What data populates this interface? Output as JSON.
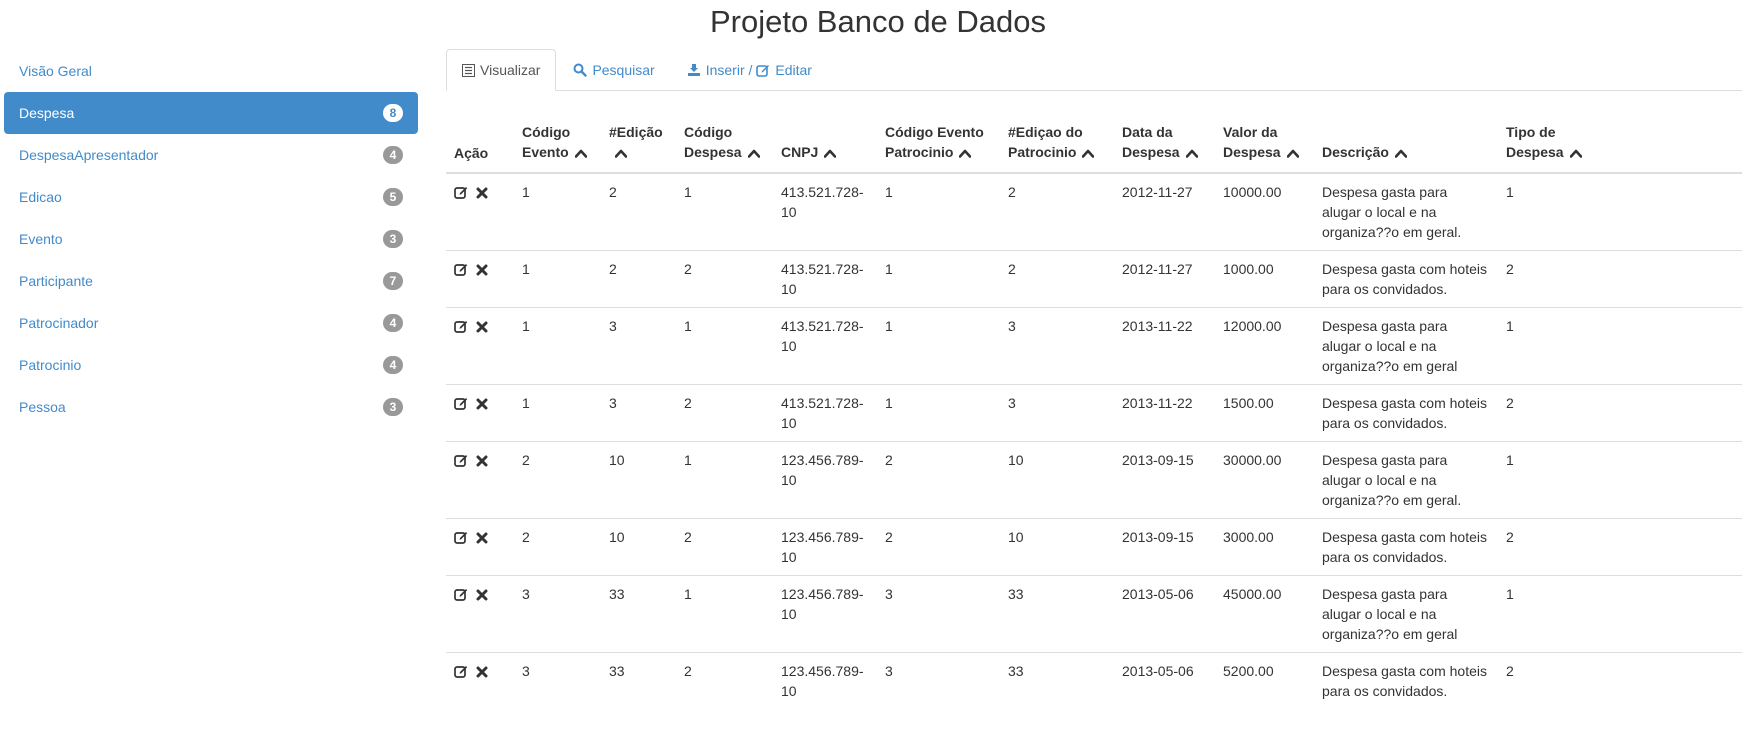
{
  "title": "Projeto Banco de Dados",
  "sidebar": {
    "items": [
      {
        "label": "Visão Geral",
        "badge": ""
      },
      {
        "label": "Despesa",
        "badge": "8"
      },
      {
        "label": "DespesaApresentador",
        "badge": "4"
      },
      {
        "label": "Edicao",
        "badge": "5"
      },
      {
        "label": "Evento",
        "badge": "3"
      },
      {
        "label": "Participante",
        "badge": "7"
      },
      {
        "label": "Patrocinador",
        "badge": "4"
      },
      {
        "label": "Patrocinio",
        "badge": "4"
      },
      {
        "label": "Pessoa",
        "badge": "3"
      }
    ],
    "active_index": 1
  },
  "tabs": {
    "visualizar": "Visualizar",
    "pesquisar": "Pesquisar",
    "inserir": "Inserir /",
    "editar": "Editar"
  },
  "table": {
    "columns": [
      {
        "line1": "",
        "line2": "Ação",
        "sortable": false
      },
      {
        "line1": "Código",
        "line2": "Evento",
        "sortable": true
      },
      {
        "line1": "#Edição",
        "line2": "",
        "sortable": true
      },
      {
        "line1": "Código",
        "line2": "Despesa",
        "sortable": true
      },
      {
        "line1": "",
        "line2": "CNPJ",
        "sortable": true
      },
      {
        "line1": "Código Evento",
        "line2": "Patrocinio",
        "sortable": true
      },
      {
        "line1": "#Ediçao do",
        "line2": "Patrocinio",
        "sortable": true
      },
      {
        "line1": "Data da",
        "line2": "Despesa",
        "sortable": true
      },
      {
        "line1": "Valor da",
        "line2": "Despesa",
        "sortable": true
      },
      {
        "line1": "",
        "line2": "Descrição",
        "sortable": true
      },
      {
        "line1": "Tipo de",
        "line2": "Despesa",
        "sortable": true
      }
    ],
    "rows": [
      [
        "1",
        "2",
        "1",
        "413.521.728-10",
        "1",
        "2",
        "2012-11-27",
        "10000.00",
        "Despesa gasta para alugar o local e na organiza??o em geral.",
        "1"
      ],
      [
        "1",
        "2",
        "2",
        "413.521.728-10",
        "1",
        "2",
        "2012-11-27",
        "1000.00",
        "Despesa gasta com hoteis para os convidados.",
        "2"
      ],
      [
        "1",
        "3",
        "1",
        "413.521.728-10",
        "1",
        "3",
        "2013-11-22",
        "12000.00",
        "Despesa gasta para alugar o local e na organiza??o em geral",
        "1"
      ],
      [
        "1",
        "3",
        "2",
        "413.521.728-10",
        "1",
        "3",
        "2013-11-22",
        "1500.00",
        "Despesa gasta com hoteis para os convidados.",
        "2"
      ],
      [
        "2",
        "10",
        "1",
        "123.456.789-10",
        "2",
        "10",
        "2013-09-15",
        "30000.00",
        "Despesa gasta para alugar o local e na organiza??o em geral.",
        "1"
      ],
      [
        "2",
        "10",
        "2",
        "123.456.789-10",
        "2",
        "10",
        "2013-09-15",
        "3000.00",
        "Despesa gasta com hoteis para os convidados.",
        "2"
      ],
      [
        "3",
        "33",
        "1",
        "123.456.789-10",
        "3",
        "33",
        "2013-05-06",
        "45000.00",
        "Despesa gasta para alugar o local e na organiza??o em geral",
        "1"
      ],
      [
        "3",
        "33",
        "2",
        "123.456.789-10",
        "3",
        "33",
        "2013-05-06",
        "5200.00",
        "Despesa gasta com hoteis para os convidados.",
        "2"
      ]
    ]
  },
  "colors": {
    "accent": "#428bca",
    "badge": "#999999",
    "border": "#dddddd"
  }
}
